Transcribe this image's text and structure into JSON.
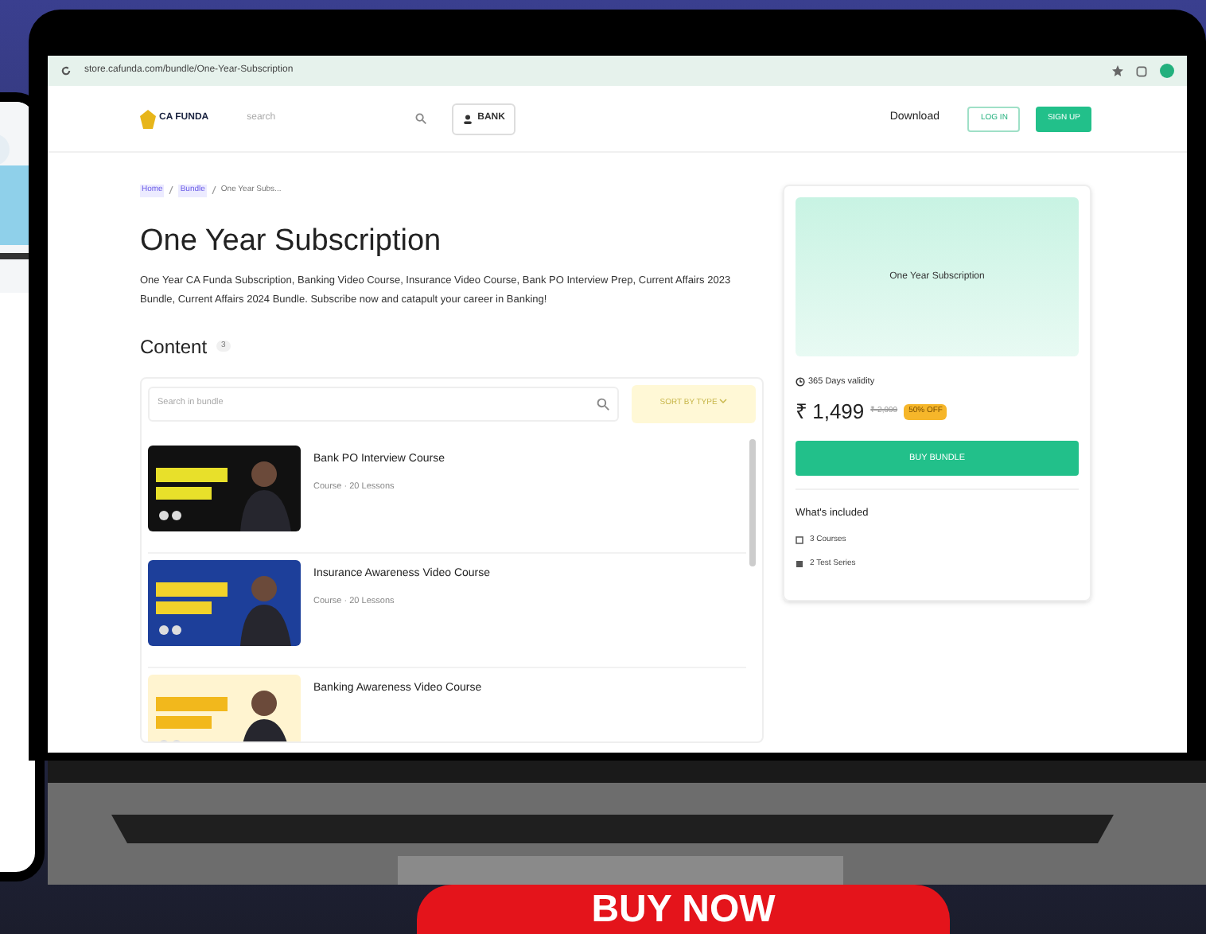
{
  "browser": {
    "url": "store.cafunda.com/bundle/One-Year-Subscription"
  },
  "header": {
    "logo": "CA FUNDA",
    "search_placeholder": "search",
    "category_button": "BANK",
    "nav_link": "Download",
    "login": "LOG IN",
    "signup": "SIGN UP"
  },
  "breadcrumb": [
    {
      "label": "Home",
      "selected": false
    },
    {
      "label": "Bundle",
      "selected": false
    },
    {
      "label": "One Year Subs...",
      "selected": true
    }
  ],
  "title": "One Year Subscription",
  "description": "One Year CA Funda Subscription, Banking Video Course, Insurance Video Course, Bank PO Interview Prep, Current Affairs 2023 Bundle, Current Affairs 2024 Bundle. Subscribe now and catapult your career in Banking!",
  "content": {
    "heading": "Content",
    "count": "3",
    "search_placeholder": "Search in bundle",
    "sort": "SORT BY TYPE",
    "items": [
      {
        "title": "Bank PO Interview Course",
        "meta": "Course · 20 Lessons",
        "kind": "dark"
      },
      {
        "title": "Insurance Awareness Video Course",
        "meta": "Course · 20 Lessons",
        "kind": "blue"
      },
      {
        "title": "Banking Awareness Video Course",
        "kind": "light"
      }
    ]
  },
  "card": {
    "banner": "One Year Subscription",
    "validity": "365 Days validity",
    "price": "₹ 1,499",
    "old_price": "₹ 2,999",
    "discount": "50% OFF",
    "buy": "BUY BUNDLE",
    "included_heading": "What's included",
    "included": [
      {
        "label": "3 Courses",
        "kind": "course"
      },
      {
        "label": "2 Test Series",
        "kind": "test"
      }
    ]
  },
  "promo_button": "BUY NOW"
}
